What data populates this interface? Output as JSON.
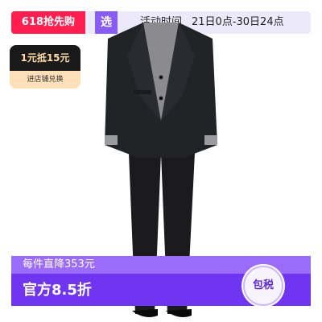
{
  "promo_bar": {
    "event_label": "618抢先购",
    "badge_label": "选",
    "activity_label": "活动时间",
    "activity_time": "21日0点-30日24点",
    "colors": {
      "bar_bg": "#ece9fb",
      "event_bg": "#ff1e4e",
      "badge_bg": "#8a5cf6"
    }
  },
  "coupon": {
    "headline": "1元抵15元",
    "action_label": "进店铺兑换",
    "colors": {
      "top_bg": "#1a1a1a",
      "bottom_bg": "#ffe0b8"
    }
  },
  "product": {
    "image_icon": "mens-suit-photo"
  },
  "price_banner": {
    "line1": "每件直降353元",
    "line2": "官方8.5折",
    "colors": {
      "main_bg": "#6f35f0",
      "top_bg": "#9b6cfb"
    }
  },
  "tax_badge": {
    "label": "包税"
  }
}
